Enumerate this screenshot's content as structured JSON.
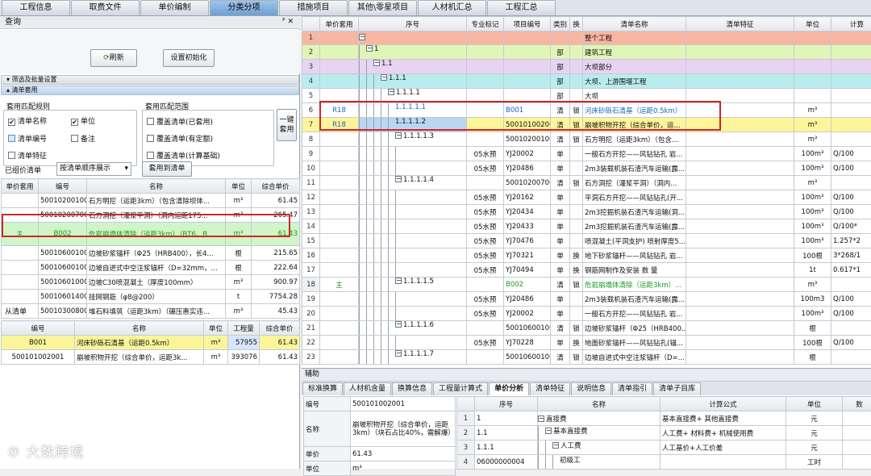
{
  "top_tabs": [
    "工程信息",
    "取费文件",
    "单价编制",
    "分类分项",
    "措施项目",
    "其他\\零星项目",
    "人材机汇总",
    "工程汇总"
  ],
  "active_top_tab": 3,
  "left": {
    "title": "查询",
    "pin": "ᴾ ✕",
    "refresh_label": "刷新",
    "reset_label": "设置初始化",
    "section_filter": "筛选及批量设置",
    "section_apply": "清单套用",
    "rule_group_title": "套用匹配规则",
    "range_group_title": "套用匹配范围",
    "rules": [
      {
        "label": "清单名称",
        "checked": true
      },
      {
        "label": "单位",
        "checked": true
      },
      {
        "label": "清单编号",
        "checked": false
      },
      {
        "label": "备注",
        "checked": false
      },
      {
        "label": "清单特征",
        "checked": false
      }
    ],
    "ranges": [
      {
        "label": "覆盖清单(已套用)"
      },
      {
        "label": "覆盖清单(有定额)"
      },
      {
        "label": "覆盖清单(计算基础)"
      }
    ],
    "apply_all_label": "一键套用",
    "grouped_label": "已组价清单",
    "sort_select": "按清单顺序展示",
    "apply_to_label": "套用到清单",
    "table1_headers": [
      "单价套用",
      "编号",
      "名称",
      "单位",
      "综合单价"
    ],
    "table1_rows": [
      [
        "",
        "500102001001",
        "石方明挖（运距3km）（包含清除坝体...",
        "m³",
        "61.45"
      ],
      [
        "",
        "500102007001",
        "石方洞挖（灌浆平洞）（洞内运距175...",
        "m³",
        "265.47"
      ],
      [
        "主",
        "B002",
        "危岩崩塌体清除（运距3km）（BT6、B...",
        "m³",
        "61.43"
      ],
      [
        "",
        "500106001001",
        "边坡砂浆锚杆（Φ25（HRB400），长4...",
        "根",
        "215.65"
      ],
      [
        "",
        "500106001002",
        "边坡自进式中空注浆锚杆（D=32mm，...",
        "根",
        "222.64"
      ],
      [
        "",
        "500106010001",
        "边坡C30喷混凝土（厚度100mm）",
        "m³",
        "900.97"
      ],
      [
        "",
        "500106014001",
        "挂网钢筋（φ8@200）",
        "t",
        "7754.28"
      ],
      [
        "",
        "500103008001",
        "堆石料填筑（运距3km）（碾压惠实违...",
        "m³",
        "45.43"
      ]
    ],
    "from_label": "从清单",
    "table2_headers": [
      "编号",
      "名称",
      "单位",
      "工程量",
      "综合单价"
    ],
    "table2_rows": [
      [
        "B001",
        "河床砂砾石清基（运距0.5km）",
        "m³",
        "57955",
        "61.43"
      ],
      [
        "500101002001",
        "崩坡积物开挖（综合单价，运距3k...",
        "m³",
        "393076",
        "61.43"
      ]
    ]
  },
  "right": {
    "headers": [
      "",
      "单价套用",
      "序号",
      "专业标记",
      "项目编号",
      "类别",
      "换",
      "清单名称",
      "清单特征",
      "单位",
      "计算"
    ],
    "rows": [
      {
        "n": "1",
        "cls": "row-salmon",
        "apply": "",
        "depth": 0,
        "box": "−",
        "seq": "",
        "mark": "",
        "code": "",
        "cat": "",
        "sw": "",
        "name": "整个工程",
        "feat": "",
        "unit": "",
        "calc": ""
      },
      {
        "n": "2",
        "cls": "row-lime",
        "apply": "",
        "depth": 1,
        "box": "−",
        "seq": "1",
        "mark": "",
        "code": "",
        "cat": "部",
        "sw": "",
        "name": "建筑工程",
        "feat": "",
        "unit": "",
        "calc": ""
      },
      {
        "n": "3",
        "cls": "row-lav",
        "apply": "",
        "depth": 2,
        "box": "−",
        "seq": "1.1",
        "mark": "",
        "code": "",
        "cat": "部",
        "sw": "",
        "name": "大坝部分",
        "feat": "",
        "unit": "",
        "calc": ""
      },
      {
        "n": "4",
        "cls": "row-cyan",
        "apply": "",
        "depth": 3,
        "box": "−",
        "seq": "1.1.1",
        "mark": "",
        "code": "",
        "cat": "部",
        "sw": "",
        "name": "大坝、上游围堰工程",
        "feat": "",
        "unit": "",
        "calc": ""
      },
      {
        "n": "5",
        "cls": "row-white",
        "apply": "",
        "depth": 4,
        "box": "−",
        "seq": "1.1.1.1",
        "mark": "",
        "code": "",
        "cat": "部",
        "sw": "",
        "name": "大坝",
        "feat": "",
        "unit": "",
        "calc": ""
      },
      {
        "n": "6",
        "cls": "row-white",
        "apply": "R18",
        "depth": 5,
        "box": "",
        "seq": "1.1.1.1.1",
        "mark": "",
        "code": "B001",
        "cat": "清",
        "sw": "锁",
        "name": "河床砂砾石清基（运距0.5km）",
        "feat": "",
        "unit": "m³",
        "calc": "",
        "blue": true
      },
      {
        "n": "7",
        "cls": "row-sel",
        "apply": "R18",
        "depth": 5,
        "box": "",
        "seq": "1.1.1.1.2",
        "mark": "",
        "code": "500101002001",
        "cat": "清",
        "sw": "锁",
        "name": "崩坡积物开挖（综合单价，运...",
        "feat": "",
        "unit": "m³",
        "calc": ""
      },
      {
        "n": "8",
        "cls": "row-white",
        "apply": "",
        "depth": 5,
        "box": "−",
        "seq": "1.1.1.1.3",
        "mark": "",
        "code": "500102001001",
        "cat": "清",
        "sw": "锁",
        "name": "石方明挖（运距3km）（包含...",
        "feat": "",
        "unit": "m³",
        "calc": ""
      },
      {
        "n": "9",
        "cls": "row-white",
        "apply": "",
        "depth": 6,
        "box": "",
        "seq": "",
        "mark": "05水预",
        "code": "YJ20002",
        "cat": "单",
        "sw": "",
        "name": "一般石方开挖——风钻钻孔 岩...",
        "feat": "",
        "unit": "100m³",
        "calc": "Q/100"
      },
      {
        "n": "10",
        "cls": "row-white",
        "apply": "",
        "depth": 6,
        "box": "",
        "seq": "",
        "mark": "05水预",
        "code": "YJ20486",
        "cat": "单",
        "sw": "",
        "name": "2m3装载机装石渣汽车运输(露...",
        "feat": "",
        "unit": "100m³",
        "calc": "Q/100"
      },
      {
        "n": "11",
        "cls": "row-white",
        "apply": "",
        "depth": 5,
        "box": "−",
        "seq": "1.1.1.1.4",
        "mark": "",
        "code": "500102007001",
        "cat": "清",
        "sw": "锁",
        "name": "石方洞挖（灌浆平洞）（洞内...",
        "feat": "",
        "unit": "m³",
        "calc": ""
      },
      {
        "n": "12",
        "cls": "row-white",
        "apply": "",
        "depth": 6,
        "box": "",
        "seq": "",
        "mark": "05水预",
        "code": "YJ20162",
        "cat": "单",
        "sw": "",
        "name": "平洞石方开挖——风钻钻孔(开...",
        "feat": "",
        "unit": "100m³",
        "calc": "Q/100"
      },
      {
        "n": "13",
        "cls": "row-white",
        "apply": "",
        "depth": 6,
        "box": "",
        "seq": "",
        "mark": "05水预",
        "code": "YJ20434",
        "cat": "单",
        "sw": "",
        "name": "2m3挖掘机装石渣汽车运输(洞...",
        "feat": "",
        "unit": "100m³",
        "calc": "Q/100"
      },
      {
        "n": "14",
        "cls": "row-white",
        "apply": "",
        "depth": 6,
        "box": "",
        "seq": "",
        "mark": "05水预",
        "code": "YJ20433",
        "cat": "单",
        "sw": "",
        "name": "2m3挖掘机装石渣汽车运输(露...",
        "feat": "",
        "unit": "100m³",
        "calc": "Q/100*"
      },
      {
        "n": "15",
        "cls": "row-white",
        "apply": "",
        "depth": 6,
        "box": "",
        "seq": "",
        "mark": "05水预",
        "code": "YJ70476",
        "cat": "单",
        "sw": "",
        "name": "喷混凝土(平洞支护) 喷射厚度5...",
        "feat": "",
        "unit": "100m³",
        "calc": "1.257*2"
      },
      {
        "n": "16",
        "cls": "row-white",
        "apply": "",
        "depth": 6,
        "box": "",
        "seq": "",
        "mark": "05水预",
        "code": "YJ70321",
        "cat": "单",
        "sw": "换",
        "name": "地下砂浆锚杆——风钻钻孔 岩...",
        "feat": "",
        "unit": "100根",
        "calc": "3*268/1"
      },
      {
        "n": "17",
        "cls": "row-white",
        "apply": "",
        "depth": 6,
        "box": "",
        "seq": "",
        "mark": "05水预",
        "code": "YJ70494",
        "cat": "单",
        "sw": "换",
        "name": "钢筋网制作及安装 数 量",
        "feat": "",
        "unit": "1t",
        "calc": "0.617*1"
      },
      {
        "n": "18",
        "cls": "row-green",
        "apply": "主",
        "depth": 5,
        "box": "−",
        "seq": "1.1.1.1.5",
        "mark": "",
        "code": "B002",
        "cat": "清",
        "sw": "锁",
        "name": "危岩崩塌体清除（运距3km）...",
        "feat": "",
        "unit": "m³",
        "calc": "",
        "green": true
      },
      {
        "n": "19",
        "cls": "row-white",
        "apply": "",
        "depth": 6,
        "box": "",
        "seq": "",
        "mark": "05水预",
        "code": "YJ20486",
        "cat": "单",
        "sw": "",
        "name": "2m3装载机装石渣汽车运输(露...",
        "feat": "",
        "unit": "100m3",
        "calc": "Q/100"
      },
      {
        "n": "20",
        "cls": "row-white",
        "apply": "",
        "depth": 6,
        "box": "",
        "seq": "",
        "mark": "05水预",
        "code": "YJ20002",
        "cat": "单",
        "sw": "",
        "name": "一般石方开挖——风钻钻孔 岩...",
        "feat": "",
        "unit": "100m³",
        "calc": "Q/100"
      },
      {
        "n": "21",
        "cls": "row-white",
        "apply": "",
        "depth": 5,
        "box": "−",
        "seq": "1.1.1.1.6",
        "mark": "",
        "code": "500106001001",
        "cat": "清",
        "sw": "锁",
        "name": "边坡砂浆锚杆（Φ25（HRB400...",
        "feat": "",
        "unit": "根",
        "calc": ""
      },
      {
        "n": "22",
        "cls": "row-white",
        "apply": "",
        "depth": 6,
        "box": "",
        "seq": "",
        "mark": "05水预",
        "code": "YJ70228",
        "cat": "单",
        "sw": "换",
        "name": "地面砂浆锚杆——风钻钻孔(锚...",
        "feat": "",
        "unit": "100根",
        "calc": "Q/100"
      },
      {
        "n": "23",
        "cls": "row-white",
        "apply": "",
        "depth": 5,
        "box": "−",
        "seq": "1.1.1.1.7",
        "mark": "",
        "code": "500106001002",
        "cat": "清",
        "sw": "锁",
        "name": "边坡自进式中空注浆锚杆（D=...",
        "feat": "",
        "unit": "根",
        "calc": ""
      }
    ]
  },
  "aux": {
    "title": "辅助",
    "tabs": [
      "标准换算",
      "人材机含量",
      "换算信息",
      "工程量计算式",
      "单价分析",
      "清单特征",
      "说明信息",
      "清单指引",
      "清单子目库"
    ],
    "active_tab": 4,
    "info": [
      {
        "k": "编号",
        "v": "500101002001"
      },
      {
        "k": "名称",
        "v": "崩坡积物开挖（综合单价，运距3km）（块石占比40%，需解爆）"
      },
      {
        "k": "单价",
        "v": "61.43"
      },
      {
        "k": "单位",
        "v": "m³"
      }
    ],
    "headers": [
      "",
      "序号",
      "名称",
      "计算公式",
      "单位",
      "数"
    ],
    "rows": [
      {
        "n": "1",
        "seq": "1",
        "depth": 0,
        "name": "直接费",
        "formula": "基本直接费+ 其他直接费",
        "unit": "元"
      },
      {
        "n": "2",
        "seq": "1.1",
        "depth": 1,
        "name": "基本直接费",
        "formula": "人工费+ 材料费+ 机械使用费",
        "unit": "元"
      },
      {
        "n": "3",
        "seq": "1.1.1",
        "depth": 2,
        "name": "人工费",
        "formula": "人工基价+人工价差",
        "unit": "元"
      },
      {
        "n": "4",
        "seq": "06000000004",
        "depth": 3,
        "name": "初级工",
        "formula": "",
        "unit": "工时"
      }
    ]
  },
  "watermark": "大数跨境"
}
